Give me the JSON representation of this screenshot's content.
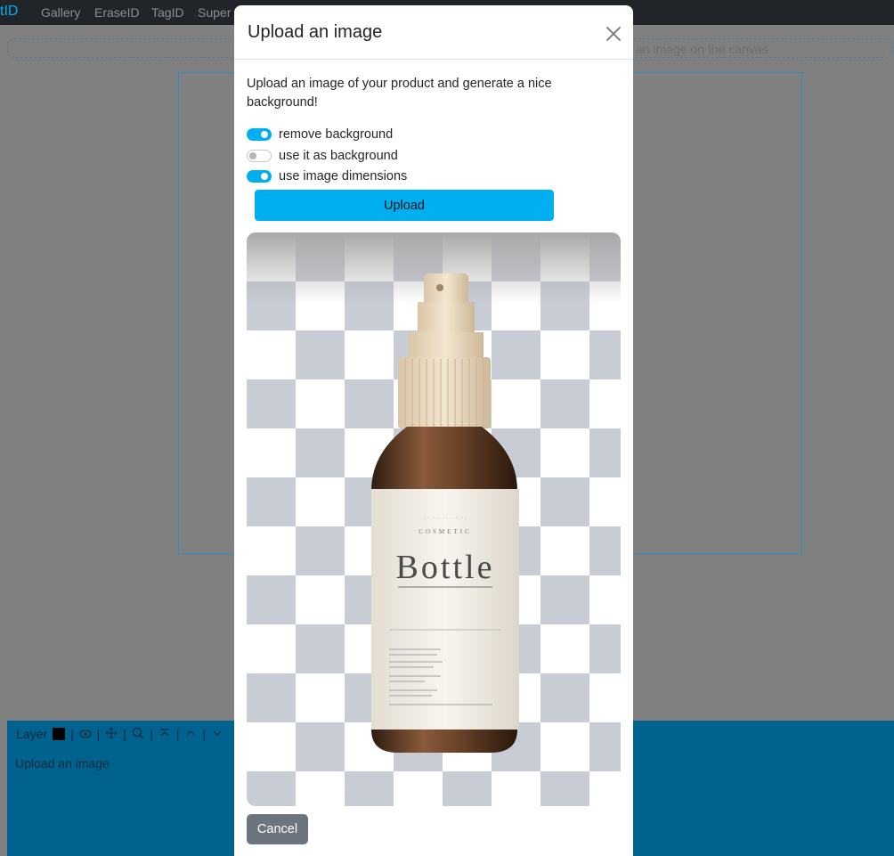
{
  "navbar": {
    "brand": "tID",
    "links": [
      "Gallery",
      "EraseID",
      "TagID",
      "Super"
    ]
  },
  "canvas": {
    "hint": "an image on the canvas"
  },
  "layers": {
    "title": "Layer",
    "items": [
      "Upload an image"
    ]
  },
  "modal": {
    "title": "Upload an image",
    "description": "Upload an image of your product and generate a nice background!",
    "options": [
      {
        "label": "remove background",
        "checked": true
      },
      {
        "label": "use it as background",
        "checked": false
      },
      {
        "label": "use image dimensions",
        "checked": true
      }
    ],
    "upload_label": "Upload",
    "cancel_label": "Cancel",
    "preview": {
      "label_text": "Bottle",
      "label_subtitle": "COSMETIC"
    }
  },
  "colors": {
    "accent": "#00aff0",
    "navbar": "#212529",
    "overlay": "#808080",
    "layer_panel": "#00628f",
    "cancel": "#6c757d"
  }
}
